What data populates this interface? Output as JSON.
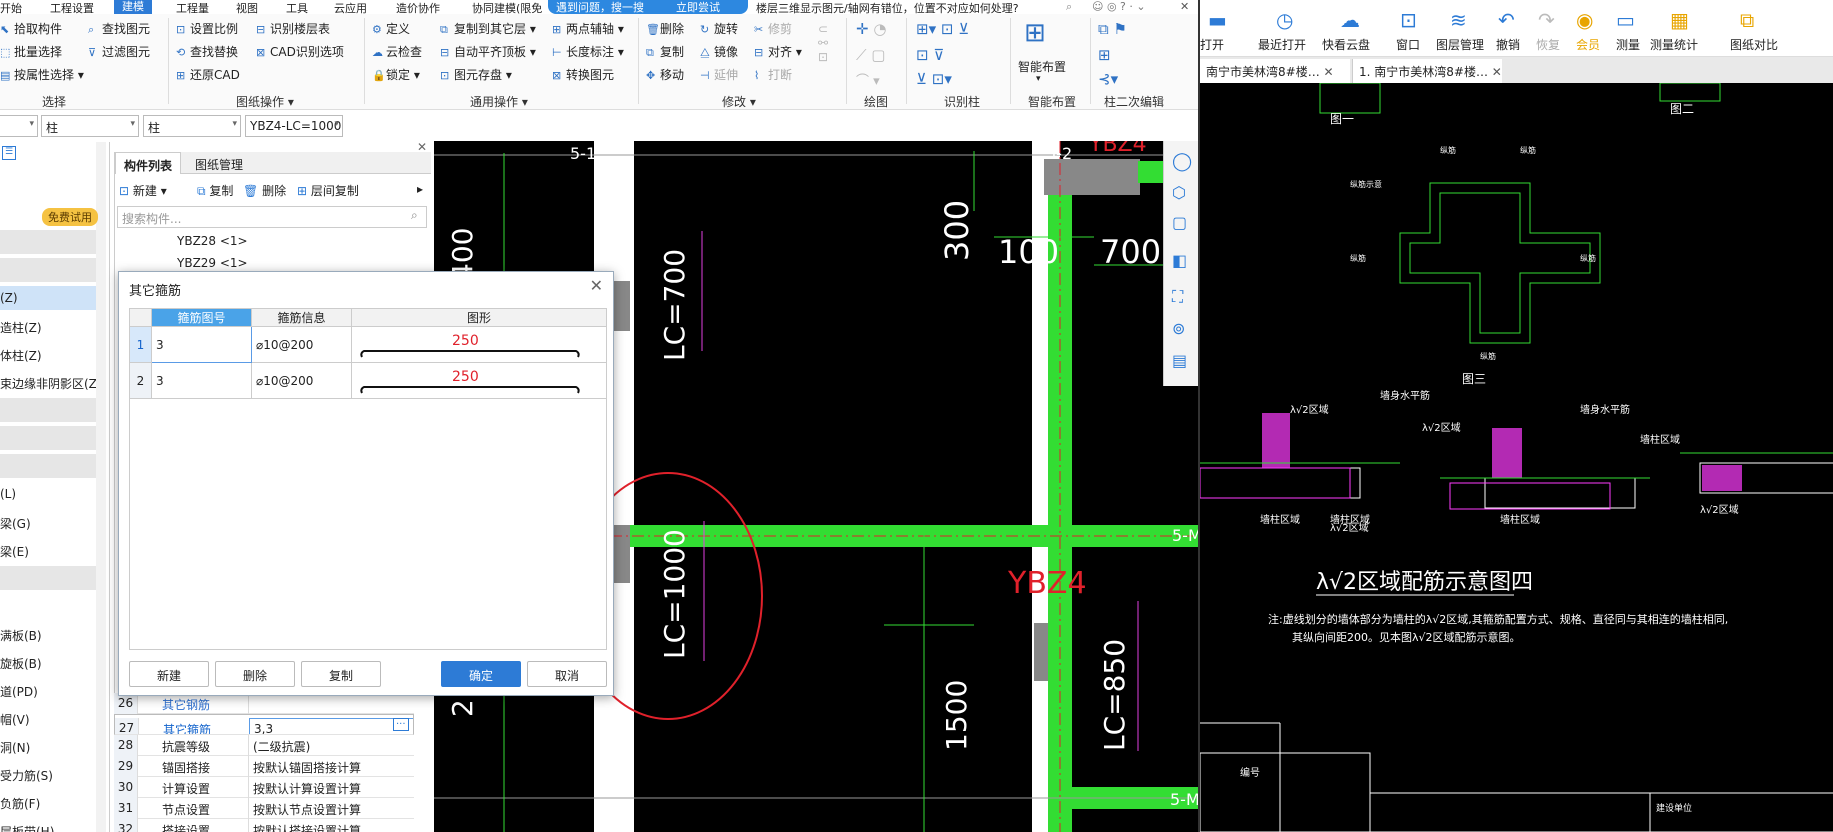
{
  "left_app": {
    "menu": [
      "开始",
      "工程设置",
      "建模",
      "工程量",
      "视图",
      "工具",
      "云应用",
      "造价协作",
      "协同建模(限免"
    ],
    "active_menu": "建模",
    "notice": {
      "text": "遇到问题，搜一搜",
      "try": "立即尝试"
    },
    "hint_text": "楼层三维显示图元/轴网有错位，位置不对应如何处理?",
    "ribbon": {
      "select": {
        "items": [
          "拾取构件",
          "批量选择",
          "按属性选择"
        ],
        "items2": [
          "查找图元",
          "过滤图元"
        ],
        "label": "选择"
      },
      "drawing_ops": {
        "items": [
          "设置比例",
          "查找替换",
          "还原CAD"
        ],
        "items2": [
          "识别楼层表",
          "CAD识别选项"
        ],
        "label": "图纸操作"
      },
      "general_ops": {
        "items": [
          "定义",
          "云检查",
          "锁定"
        ],
        "items2": [
          "复制到其它层",
          "自动平齐顶板",
          "图元存盘"
        ],
        "items3": [
          "两点辅轴",
          "长度标注",
          "转换图元"
        ],
        "label": "通用操作"
      },
      "modify": {
        "items": [
          "删除",
          "复制",
          "移动"
        ],
        "items2": [
          "旋转",
          "镜像"
        ],
        "items3": [
          "修剪",
          "对齐",
          "延伸",
          "打断"
        ],
        "label": "修改"
      },
      "draw": {
        "label": "绘图"
      },
      "identify_col": {
        "label": "识别柱"
      },
      "smart": {
        "btn": "智能布置",
        "label": "智能布置"
      },
      "col_edit": {
        "label": "柱二次编辑"
      }
    },
    "toolbar_selects": [
      "柱",
      "柱",
      "YBZ4-LC=1000"
    ],
    "nav_items": [
      "(Z)",
      "造柱(Z)",
      "体柱(Z)",
      "束边缘非阴影区(Z",
      "(L)",
      "梁(G)",
      "梁(E)",
      "满板(B)",
      "旋板(B)",
      "道(PD)",
      "帽(V)",
      "洞(N)",
      "受力筋(S)",
      "负筋(F)",
      "层板带(H)"
    ],
    "free_badge": "免费试用",
    "comp_panel": {
      "tabs": [
        "构件列表",
        "图纸管理"
      ],
      "tools": [
        "新建",
        "复制",
        "删除",
        "层间复制"
      ],
      "search_placeholder": "搜索构件...",
      "list": [
        "YBZ28 <1>",
        "YBZ29 <1>"
      ]
    },
    "props": [
      {
        "n": "26",
        "k": "其它钢筋",
        "v": ""
      },
      {
        "n": "27",
        "k": "其它箍筋",
        "v": "3,3"
      },
      {
        "n": "28",
        "k": "抗震等级",
        "v": "(二级抗震)"
      },
      {
        "n": "29",
        "k": "锚固搭接",
        "v": "按默认锚固搭接计算"
      },
      {
        "n": "30",
        "k": "计算设置",
        "v": "按默认计算设置计算"
      },
      {
        "n": "31",
        "k": "节点设置",
        "v": "按默认节点设置计算"
      },
      {
        "n": "32",
        "k": "搭接设置",
        "v": "按默认搭接设置计算"
      }
    ],
    "dialog": {
      "title": "其它箍筋",
      "headers": [
        "箍筋图号",
        "箍筋信息",
        "图形"
      ],
      "rows": [
        {
          "idx": "1",
          "no": "3",
          "info": "⌀10@200",
          "dim": "250"
        },
        {
          "idx": "2",
          "no": "3",
          "info": "⌀10@200",
          "dim": "250"
        }
      ],
      "buttons": {
        "new": "新建",
        "delete": "删除",
        "copy": "复制",
        "ok": "确定",
        "cancel": "取消"
      }
    },
    "cad": {
      "labels": [
        "5-1",
        "5-2",
        "YBZ4",
        "YBZ4",
        "5-M",
        "5-M"
      ],
      "dims": [
        "300",
        "100",
        "700",
        "LC=700",
        "LC=1000",
        "1500",
        "LC=850",
        "400",
        "2"
      ],
      "colors": {
        "wall": "#33dd33",
        "dim": "#ffffff",
        "annot": "#e0212b",
        "axis": "#c0c0c0"
      }
    }
  },
  "right_app": {
    "toolbar": [
      "打开",
      "最近打开",
      "快看云盘",
      "窗口",
      "图层管理",
      "撤销",
      "恢复",
      "会员",
      "测量",
      "测量统计",
      "图纸对比"
    ],
    "tabs": [
      "南宁市美林湾8#楼…",
      "1. 南宁市美林湾8#楼…"
    ],
    "drawing": {
      "fig_labels": [
        "图一",
        "图二",
        "图三"
      ],
      "tags": [
        "墙身水平筋",
        "墙柱区域",
        "λ√2区域",
        "墙柱区域",
        "λ√2区域",
        "墙身水平筋",
        "λ√2区域",
        "墙柱区域",
        "墙柱区域",
        "λ√2区域"
      ],
      "heading": "λ√2区域配筋示意图四",
      "note1": "注:虚线划分的墙体部分为墙柱的λ√2区域,其箍筋配置方式、规格、直径同与其相连的墙柱相同,",
      "note2": "其纵向间距200。见本图λ√2区域配筋示意图。",
      "table_label": "编号",
      "table_label2": "建设单位"
    }
  }
}
